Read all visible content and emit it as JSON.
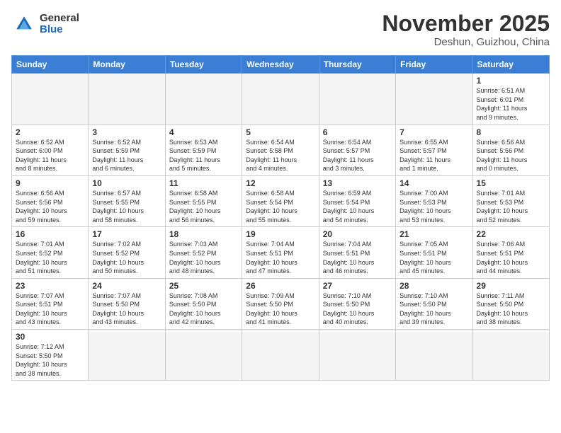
{
  "header": {
    "logo_general": "General",
    "logo_blue": "Blue",
    "month_title": "November 2025",
    "location": "Deshun, Guizhou, China"
  },
  "weekdays": [
    "Sunday",
    "Monday",
    "Tuesday",
    "Wednesday",
    "Thursday",
    "Friday",
    "Saturday"
  ],
  "days": [
    {
      "num": "",
      "info": "",
      "empty": true
    },
    {
      "num": "",
      "info": "",
      "empty": true
    },
    {
      "num": "",
      "info": "",
      "empty": true
    },
    {
      "num": "",
      "info": "",
      "empty": true
    },
    {
      "num": "",
      "info": "",
      "empty": true
    },
    {
      "num": "",
      "info": "",
      "empty": true
    },
    {
      "num": "1",
      "info": "Sunrise: 6:51 AM\nSunset: 6:01 PM\nDaylight: 11 hours\nand 9 minutes."
    },
    {
      "num": "2",
      "info": "Sunrise: 6:52 AM\nSunset: 6:00 PM\nDaylight: 11 hours\nand 8 minutes."
    },
    {
      "num": "3",
      "info": "Sunrise: 6:52 AM\nSunset: 5:59 PM\nDaylight: 11 hours\nand 6 minutes."
    },
    {
      "num": "4",
      "info": "Sunrise: 6:53 AM\nSunset: 5:59 PM\nDaylight: 11 hours\nand 5 minutes."
    },
    {
      "num": "5",
      "info": "Sunrise: 6:54 AM\nSunset: 5:58 PM\nDaylight: 11 hours\nand 4 minutes."
    },
    {
      "num": "6",
      "info": "Sunrise: 6:54 AM\nSunset: 5:57 PM\nDaylight: 11 hours\nand 3 minutes."
    },
    {
      "num": "7",
      "info": "Sunrise: 6:55 AM\nSunset: 5:57 PM\nDaylight: 11 hours\nand 1 minute."
    },
    {
      "num": "8",
      "info": "Sunrise: 6:56 AM\nSunset: 5:56 PM\nDaylight: 11 hours\nand 0 minutes."
    },
    {
      "num": "9",
      "info": "Sunrise: 6:56 AM\nSunset: 5:56 PM\nDaylight: 10 hours\nand 59 minutes."
    },
    {
      "num": "10",
      "info": "Sunrise: 6:57 AM\nSunset: 5:55 PM\nDaylight: 10 hours\nand 58 minutes."
    },
    {
      "num": "11",
      "info": "Sunrise: 6:58 AM\nSunset: 5:55 PM\nDaylight: 10 hours\nand 56 minutes."
    },
    {
      "num": "12",
      "info": "Sunrise: 6:58 AM\nSunset: 5:54 PM\nDaylight: 10 hours\nand 55 minutes."
    },
    {
      "num": "13",
      "info": "Sunrise: 6:59 AM\nSunset: 5:54 PM\nDaylight: 10 hours\nand 54 minutes."
    },
    {
      "num": "14",
      "info": "Sunrise: 7:00 AM\nSunset: 5:53 PM\nDaylight: 10 hours\nand 53 minutes."
    },
    {
      "num": "15",
      "info": "Sunrise: 7:01 AM\nSunset: 5:53 PM\nDaylight: 10 hours\nand 52 minutes."
    },
    {
      "num": "16",
      "info": "Sunrise: 7:01 AM\nSunset: 5:52 PM\nDaylight: 10 hours\nand 51 minutes."
    },
    {
      "num": "17",
      "info": "Sunrise: 7:02 AM\nSunset: 5:52 PM\nDaylight: 10 hours\nand 50 minutes."
    },
    {
      "num": "18",
      "info": "Sunrise: 7:03 AM\nSunset: 5:52 PM\nDaylight: 10 hours\nand 48 minutes."
    },
    {
      "num": "19",
      "info": "Sunrise: 7:04 AM\nSunset: 5:51 PM\nDaylight: 10 hours\nand 47 minutes."
    },
    {
      "num": "20",
      "info": "Sunrise: 7:04 AM\nSunset: 5:51 PM\nDaylight: 10 hours\nand 46 minutes."
    },
    {
      "num": "21",
      "info": "Sunrise: 7:05 AM\nSunset: 5:51 PM\nDaylight: 10 hours\nand 45 minutes."
    },
    {
      "num": "22",
      "info": "Sunrise: 7:06 AM\nSunset: 5:51 PM\nDaylight: 10 hours\nand 44 minutes."
    },
    {
      "num": "23",
      "info": "Sunrise: 7:07 AM\nSunset: 5:51 PM\nDaylight: 10 hours\nand 43 minutes."
    },
    {
      "num": "24",
      "info": "Sunrise: 7:07 AM\nSunset: 5:50 PM\nDaylight: 10 hours\nand 43 minutes."
    },
    {
      "num": "25",
      "info": "Sunrise: 7:08 AM\nSunset: 5:50 PM\nDaylight: 10 hours\nand 42 minutes."
    },
    {
      "num": "26",
      "info": "Sunrise: 7:09 AM\nSunset: 5:50 PM\nDaylight: 10 hours\nand 41 minutes."
    },
    {
      "num": "27",
      "info": "Sunrise: 7:10 AM\nSunset: 5:50 PM\nDaylight: 10 hours\nand 40 minutes."
    },
    {
      "num": "28",
      "info": "Sunrise: 7:10 AM\nSunset: 5:50 PM\nDaylight: 10 hours\nand 39 minutes."
    },
    {
      "num": "29",
      "info": "Sunrise: 7:11 AM\nSunset: 5:50 PM\nDaylight: 10 hours\nand 38 minutes."
    },
    {
      "num": "30",
      "info": "Sunrise: 7:12 AM\nSunset: 5:50 PM\nDaylight: 10 hours\nand 38 minutes."
    },
    {
      "num": "",
      "info": "",
      "empty": true
    },
    {
      "num": "",
      "info": "",
      "empty": true
    },
    {
      "num": "",
      "info": "",
      "empty": true
    },
    {
      "num": "",
      "info": "",
      "empty": true
    },
    {
      "num": "",
      "info": "",
      "empty": true
    },
    {
      "num": "",
      "info": "",
      "empty": true
    }
  ]
}
